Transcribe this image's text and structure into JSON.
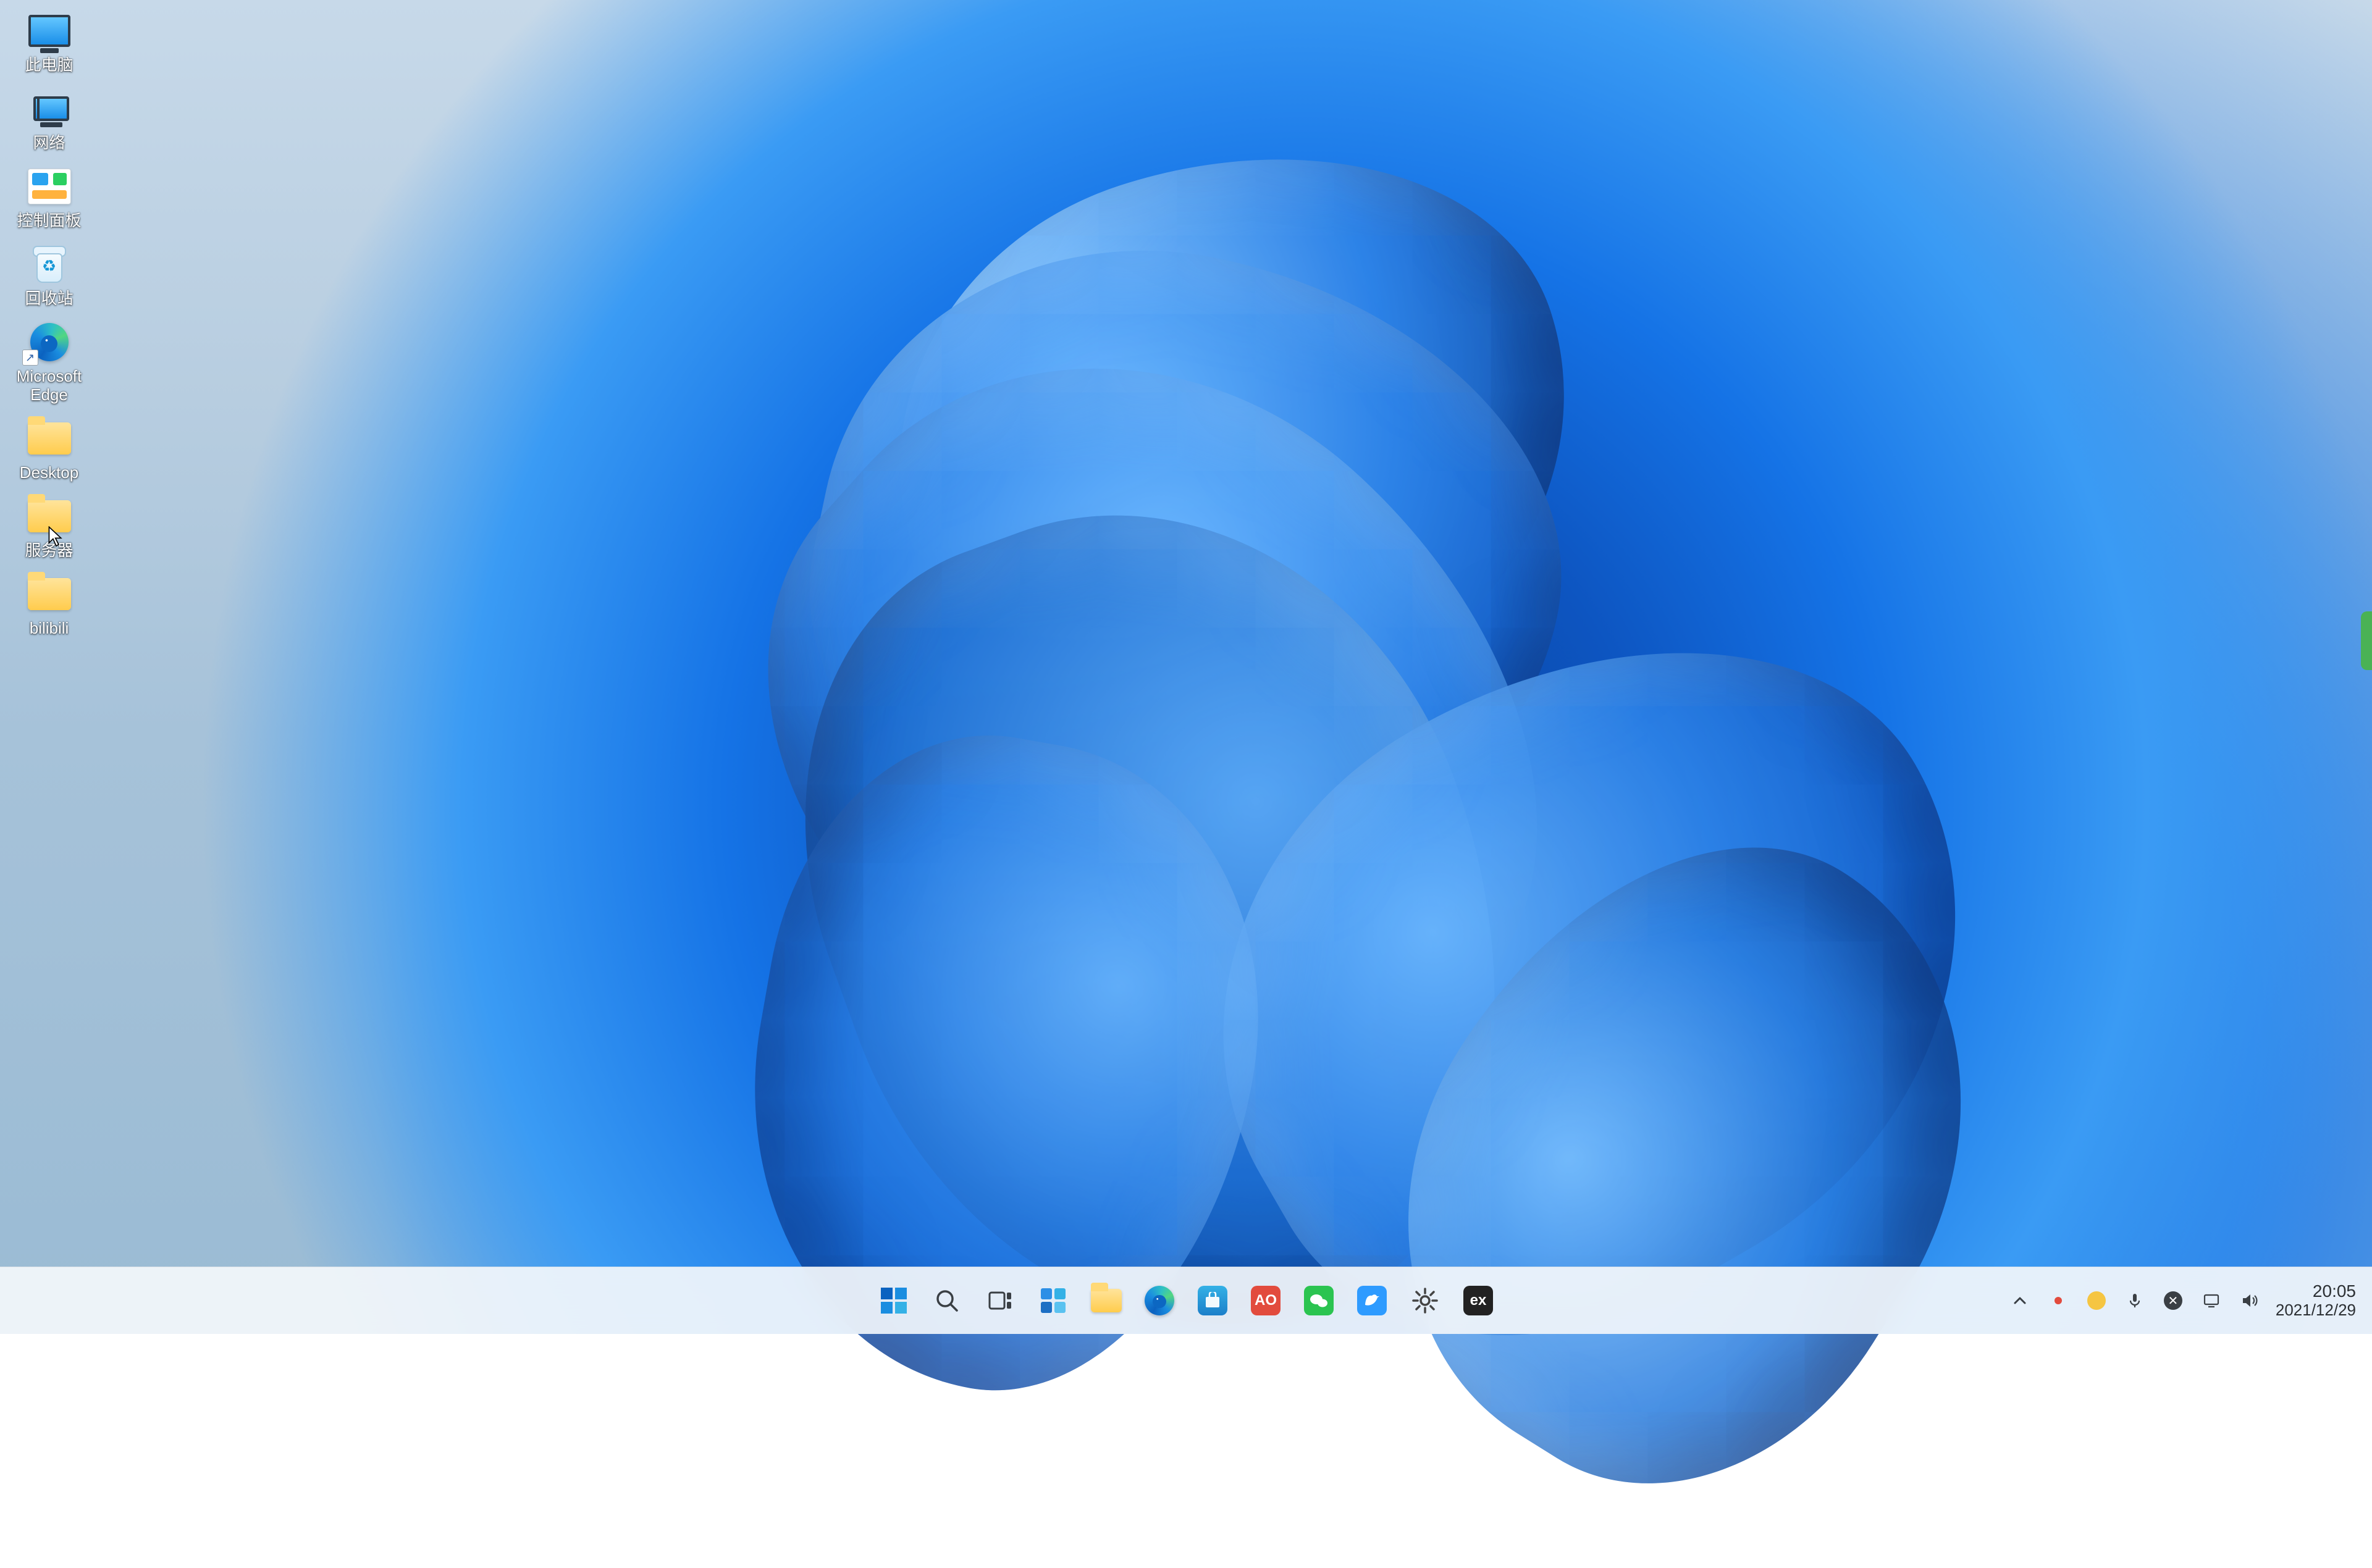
{
  "desktop_icons": [
    {
      "id": "this-pc",
      "label": "此电脑"
    },
    {
      "id": "network",
      "label": "网络"
    },
    {
      "id": "control-panel",
      "label": "控制面板"
    },
    {
      "id": "recycle-bin",
      "label": "回收站"
    },
    {
      "id": "edge",
      "label": "Microsoft Edge"
    },
    {
      "id": "desktop-folder",
      "label": "Desktop"
    },
    {
      "id": "server-folder",
      "label": "服务器"
    },
    {
      "id": "bilibili-folder",
      "label": "bilibili"
    }
  ],
  "taskbar": {
    "center": [
      {
        "id": "start",
        "name": "start-button"
      },
      {
        "id": "search",
        "name": "search-button"
      },
      {
        "id": "taskview",
        "name": "task-view-button"
      },
      {
        "id": "widgets",
        "name": "widgets-button"
      },
      {
        "id": "explorer",
        "name": "file-explorer-button"
      },
      {
        "id": "edge",
        "name": "edge-button"
      },
      {
        "id": "store",
        "name": "microsoft-store-button"
      },
      {
        "id": "ao",
        "name": "app-red-button",
        "letter": "AO"
      },
      {
        "id": "wechat",
        "name": "wechat-button"
      },
      {
        "id": "thunderbird",
        "name": "bird-app-button"
      },
      {
        "id": "settings",
        "name": "settings-button"
      },
      {
        "id": "dev",
        "name": "dev-app-button",
        "letter": "ex"
      }
    ],
    "tray": {
      "chevron": "⌃",
      "time": "20:05",
      "date": "2021/12/29"
    }
  }
}
